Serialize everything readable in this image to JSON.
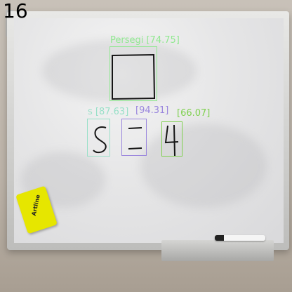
{
  "frame": {
    "number": "16"
  },
  "detections": [
    {
      "label": "Persegi [74.75]",
      "color": "#90e890"
    },
    {
      "label": "s [87.63]",
      "color": "#99e0c8"
    },
    {
      "label": "[94.31]",
      "color": "#9a86dd"
    },
    {
      "label": "[66.07]",
      "color": "#7fd04f"
    }
  ],
  "eraser": {
    "brand": "Artline"
  }
}
